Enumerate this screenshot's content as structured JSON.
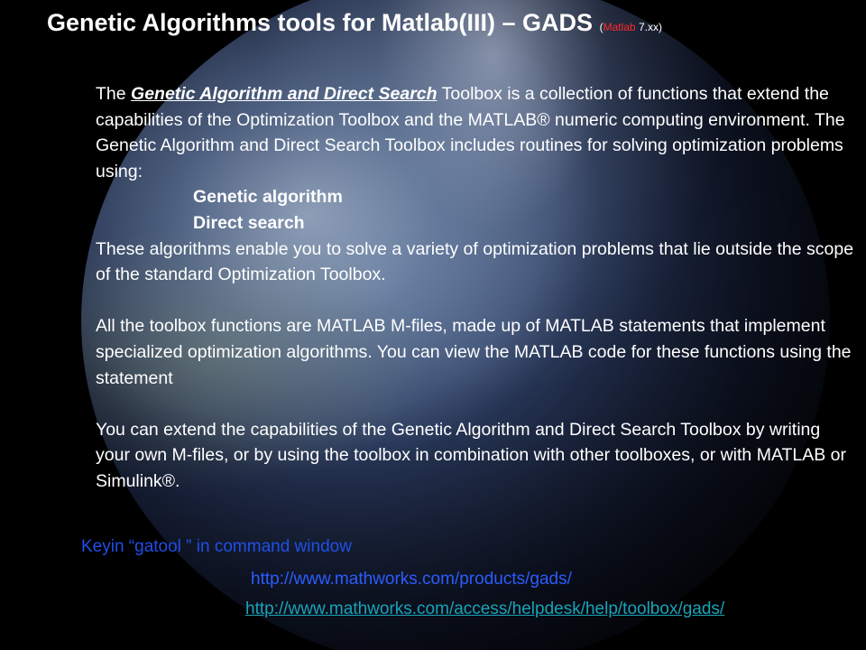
{
  "title": {
    "main": "Genetic Algorithms tools for Matlab(III) – GADS",
    "note_open": "(",
    "note_red": "Matlab",
    "note_rest": " 7.xx)"
  },
  "body": {
    "p1_pre": "The ",
    "p1_em": "Genetic Algorithm and Direct Search",
    "p1_post": " Toolbox is a collection of functions that extend the capabilities of the Optimization Toolbox and the MATLAB® numeric computing environment. The Genetic Algorithm and Direct Search Toolbox includes routines for solving optimization problems using:",
    "item1": "Genetic algorithm",
    "item2": "Direct search",
    "p2": "These algorithms enable you to solve a variety of optimization problems that lie outside the scope of the standard Optimization Toolbox.",
    "p3": "All the toolbox functions are MATLAB  M-files, made up of MATLAB  statements that implement specialized optimization algorithms. You can view  the MATLAB code for these functions using the statement",
    "p4": "You can extend the capabilities of the Genetic Algorithm and Direct Search Toolbox by writing your own M-files, or by using the toolbox in combination with other toolboxes, or with MATLAB  or Simulink®."
  },
  "footer": {
    "keyin": "Keyin “gatool ” in command window",
    "link1": "http://www.mathworks.com/products/gads/",
    "link2": "http://www.mathworks.com/access/helpdesk/help/toolbox/gads/"
  },
  "colors": {
    "background": "#000000",
    "title_note_red": "#ff2a2a",
    "keyin_blue": "#1f4fe8",
    "link1_blue": "#2b5cff",
    "link2_teal": "#19a3b8"
  }
}
